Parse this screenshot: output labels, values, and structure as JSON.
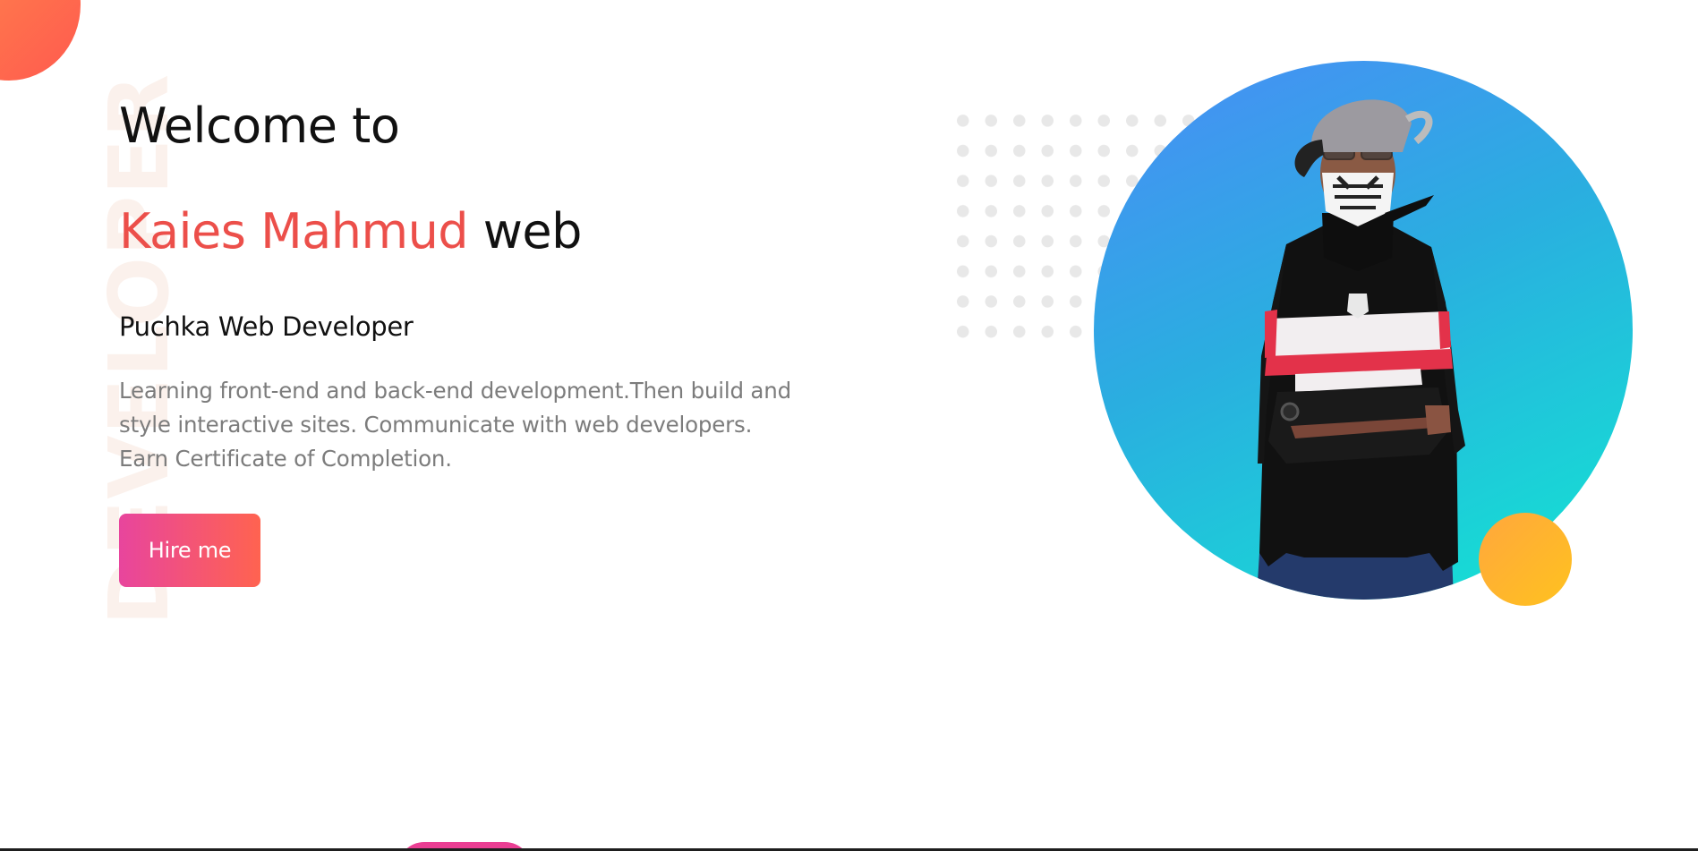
{
  "vertical_word": "DEVELOPER",
  "hero": {
    "welcome": "Welcome to",
    "name": "Kaies Mahmud",
    "name_suffix": "web",
    "role": "Puchka Web Developer",
    "description": "Learning front-end and back-end development.Then build and style interactive sites. Communicate with web developers. Earn Certificate of Completion.",
    "hire_button": "Hire me"
  },
  "colors": {
    "accent_name": "#ec4f4a",
    "button_gradient": [
      "#e8459d",
      "#ff6350"
    ],
    "portrait_gradient": [
      "#4a8cf7",
      "#12e6d2"
    ],
    "small_circle": "#ffb22a"
  },
  "icons": {
    "portrait": "person-photo"
  }
}
